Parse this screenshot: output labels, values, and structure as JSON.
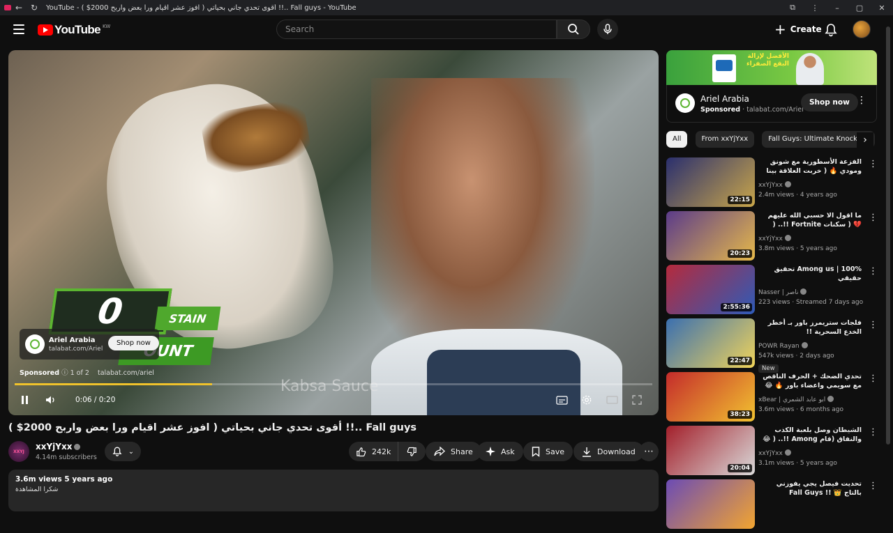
{
  "browser": {
    "tab_title": "YouTube - ( $2000 أقوى تحدي جاني بحياتي ( افوز عشر اقيام ورا بعض واربح !!.. Fall guys - YouTube"
  },
  "masthead": {
    "logo_text": "YouTube",
    "country_code": "KW",
    "search_placeholder": "Search",
    "create_label": "Create"
  },
  "player": {
    "overlay_counter": "0",
    "overlay_stain": "STAIN",
    "overlay_count": "OUNT",
    "caption": "Kabsa Sauce",
    "ad_card": {
      "name": "Ariel Arabia",
      "url": "talabat.com/Ariel",
      "shop_label": "Shop now"
    },
    "sponsored": {
      "label": "Sponsored",
      "info": "1 of 2",
      "url": "talabat.com/ariel"
    },
    "time_text": "0:06 / 0:20",
    "progress_played_pct": 31,
    "progress_loaded_pct": 31
  },
  "video": {
    "title": "( $2000 أقوى تحدي جاني بحياتي ( افوز عشر اقيام ورا بعض واربح !!.. Fall guys",
    "channel_name": "xxYjYxx",
    "subscribers": "4.14m subscribers",
    "likes": "242k",
    "share_label": "Share",
    "ask_label": "Ask",
    "save_label": "Save",
    "download_label": "Download",
    "description_meta": "3.6m views  5 years ago",
    "description_line": "شكرا المشاهدة"
  },
  "sidebar_ad": {
    "banner_line1": "الأفضل لإزالة",
    "banner_line2": "البقع الصفراء",
    "name": "Ariel Arabia",
    "sponsored": "Sponsored",
    "url": "talabat.com/Ariel",
    "shop_label": "Shop now"
  },
  "chips": [
    "All",
    "From xxYjYxx",
    "Fall Guys: Ultimate Knockout"
  ],
  "recommendations": [
    {
      "title": "الفزعة الأسطورية مع شونق ومودي 🔥 ( خربت العلاقة بينا 😂 💔 ) ..!!",
      "channel": "xxYjYxx",
      "meta": "2.4m views · 4 years ago",
      "duration": "22:15",
      "colors": [
        "#2a2f6e",
        "#c9a64a"
      ]
    },
    {
      "title": "ما اقول الا حسبي الله عليهم 💔 ( سكنات Fortnite !!.. ( سكنات ابو بكس vs الحب",
      "channel": "xxYjYxx",
      "meta": "3.8m views · 5 years ago",
      "duration": "20:23",
      "colors": [
        "#5b3b8a",
        "#e6b94a"
      ]
    },
    {
      "title": "Among us | 100% تحقيق حقيقي",
      "channel": "Nasser | ناصر",
      "meta": "223 views · Streamed 7 days ago",
      "duration": "2:55:36",
      "colors": [
        "#b52a3c",
        "#2e5bb8"
      ]
    },
    {
      "title": "فلجات ستريمرز باور بـ أخطر الخدع السحرية !!",
      "channel": "POWR Rayan",
      "meta": "547k views · 2 days ago",
      "duration": "22:47",
      "badge": "New",
      "colors": [
        "#3a6fb0",
        "#f0d45a"
      ]
    },
    {
      "title": "تحدي الضحك + الحرف الناقص مع سويمي واعضاء باور 🔥 😂",
      "channel": "xBear | ابو عابد الشمري",
      "meta": "3.6m views · 6 months ago",
      "duration": "38:23",
      "colors": [
        "#c42b2b",
        "#f2c230"
      ]
    },
    {
      "title": "الشيطان وصل بلعبة الكذب والنفاق (قام Among !!.. ( 😂 سبني ويتقل من الكذب",
      "channel": "xxYjYxx",
      "meta": "3.1m views · 5 years ago",
      "duration": "20:04",
      "colors": [
        "#a31f2a",
        "#d9d9d9"
      ]
    },
    {
      "title": "تحديت فيصل يجي يفوزني بالتاج 👑 !! Fall Guys",
      "channel": "",
      "meta": "",
      "duration": "",
      "colors": [
        "#6b4bb5",
        "#f2a530"
      ]
    }
  ]
}
